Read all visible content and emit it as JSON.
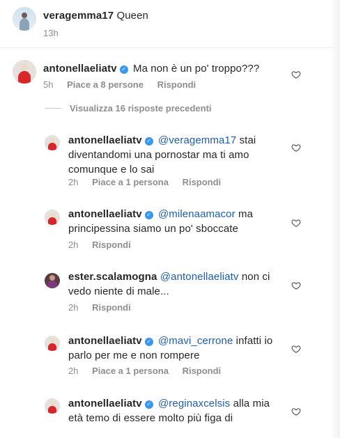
{
  "post_header": {
    "username": "veragemma17",
    "text": "Queen",
    "time": "13h"
  },
  "comment_main": {
    "username": "antonellaeliatv",
    "verified": true,
    "text": "Ma non è un po' troppo???",
    "time": "5h",
    "likes": "Piace a 8 persone",
    "reply": "Rispondi"
  },
  "view_replies": "Visualizza 16 risposte precedenti",
  "replies": [
    {
      "username": "antonellaeliatv",
      "mention": "@veragemma17",
      "text_line1": "stai",
      "text_line2": "diventandomi una pornostar ma ti amo",
      "text_line3": "comunque e lo sai",
      "time": "2h",
      "likes": "Piace a 1 persona",
      "reply": "Rispondi"
    },
    {
      "username": "antonellaeliatv",
      "mention": "@milenaamacor",
      "text_line1": "ma",
      "text_line2": "principessina siamo un po' sboccate",
      "time": "2h",
      "reply": "Rispondi"
    },
    {
      "username": "ester.scalamogna",
      "mention": "@antonellaeliatv",
      "text_line1": "non ci",
      "text_line2": "vedo niente di male...",
      "time": "2h",
      "reply": "Rispondi"
    },
    {
      "username": "antonellaeliatv",
      "mention": "@mavi_cerrone",
      "text_line1": "infatti io",
      "text_line2": "parlo per me e non rompere",
      "time": "2h",
      "likes": "Piace a 1 persona",
      "reply": "Rispondi"
    },
    {
      "username": "antonellaeliatv",
      "mention": "@reginaxcelsis",
      "text_line1": "alla mia",
      "text_line2": "età temo di essere molto più figa di"
    }
  ],
  "icons": {
    "like": "heart-outline-icon",
    "verified": "verified-badge-icon"
  },
  "colors": {
    "text": "#262626",
    "meta": "#8e8e8e",
    "mention": "#1f5ea8",
    "verified": "#3897f0"
  }
}
